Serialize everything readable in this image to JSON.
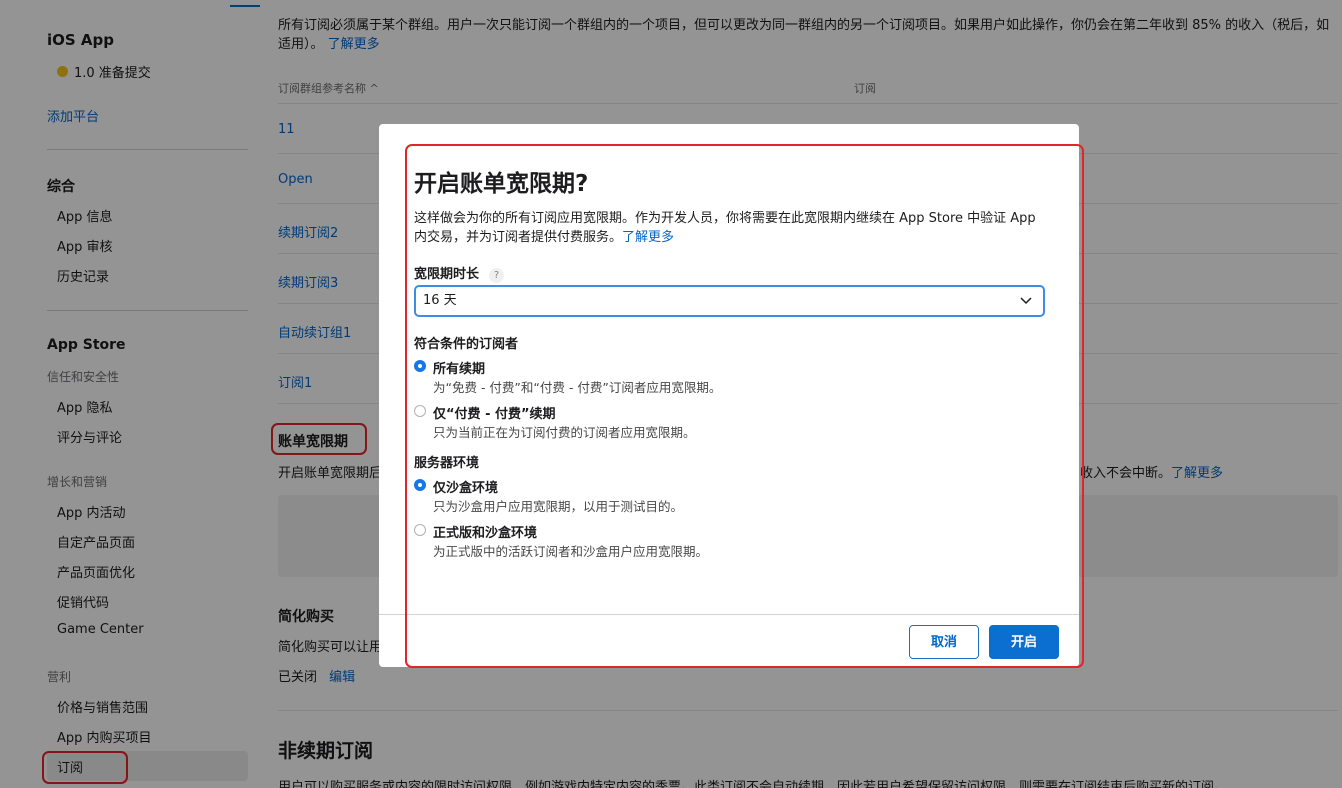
{
  "sidebar": {
    "app_title": "iOS App",
    "status": "1.0 准备提交",
    "add_platform": "添加平台",
    "general_heading": "综合",
    "general_items": [
      "App 信息",
      "App 审核",
      "历史记录"
    ],
    "appstore_heading": "App Store",
    "trust_group": "信任和安全性",
    "trust_items": [
      "App 隐私",
      "评分与评论"
    ],
    "growth_group": "增长和营销",
    "growth_items": [
      "App 内活动",
      "自定产品页面",
      "产品页面优化",
      "促销代码",
      "Game Center"
    ],
    "profit_group": "营利",
    "profit_items": [
      "价格与销售范围",
      "App 内购买项目",
      "订阅"
    ]
  },
  "main": {
    "top_text": "所有订阅必须属于某个群组。用户一次只能订阅一个群组内的一个项目，但可以更改为同一群组内的另一个订阅项目。如果用户如此操作，你仍会在第二年收到 85% 的收入（税后，如适用）。",
    "learn_more": "了解更多",
    "col_group_ref": "订阅群组参考名称 ^",
    "col_subscription": "订阅",
    "groups": [
      "11",
      "Open",
      "续期订阅2",
      "续期订阅3",
      "自动续订组1",
      "订阅1"
    ],
    "billing_heading": "账单宽限期",
    "billing_text_left": "开启账单宽限期后",
    "billing_text_right": "收入不会中断。",
    "simplified_heading": "简化购买",
    "simplified_text": "简化购买可以让用",
    "simplified_status": "已关闭",
    "edit": "编辑",
    "nonrenew_heading": "非续期订阅",
    "nonrenew_text": "用户可以购买服务或内容的限时访问权限，例如游戏内特定内容的季票。此类订阅不会自动续期，因此若用户希望保留访问权限，则需要在订阅结束后购买新的订阅。"
  },
  "modal": {
    "title": "开启账单宽限期?",
    "desc": "这样做会为你的所有订阅应用宽限期。作为开发人员，你将需要在此宽限期内继续在 App Store 中验证 App 内交易，并为订阅者提供付费服务。",
    "learn_more": "了解更多",
    "duration_label": "宽限期时长",
    "help": "?",
    "duration_value": "16 天",
    "eligible_label": "符合条件的订阅者",
    "eligible_options": [
      {
        "label": "所有续期",
        "sub": "为“免费 - 付费”和“付费 - 付费”订阅者应用宽限期。",
        "selected": true
      },
      {
        "label": "仅“付费 - 付费”续期",
        "sub": "只为当前正在为订阅付费的订阅者应用宽限期。",
        "selected": false
      }
    ],
    "env_label": "服务器环境",
    "env_options": [
      {
        "label": "仅沙盒环境",
        "sub": "只为沙盒用户应用宽限期，以用于测试目的。",
        "selected": true
      },
      {
        "label": "正式版和沙盒环境",
        "sub": "为正式版中的活跃订阅者和沙盒用户应用宽限期。",
        "selected": false
      }
    ],
    "cancel": "取消",
    "confirm": "开启"
  },
  "colors": {
    "accent": "#0066cc",
    "highlight": "#e0262b",
    "status_dot": "#f5c518"
  }
}
